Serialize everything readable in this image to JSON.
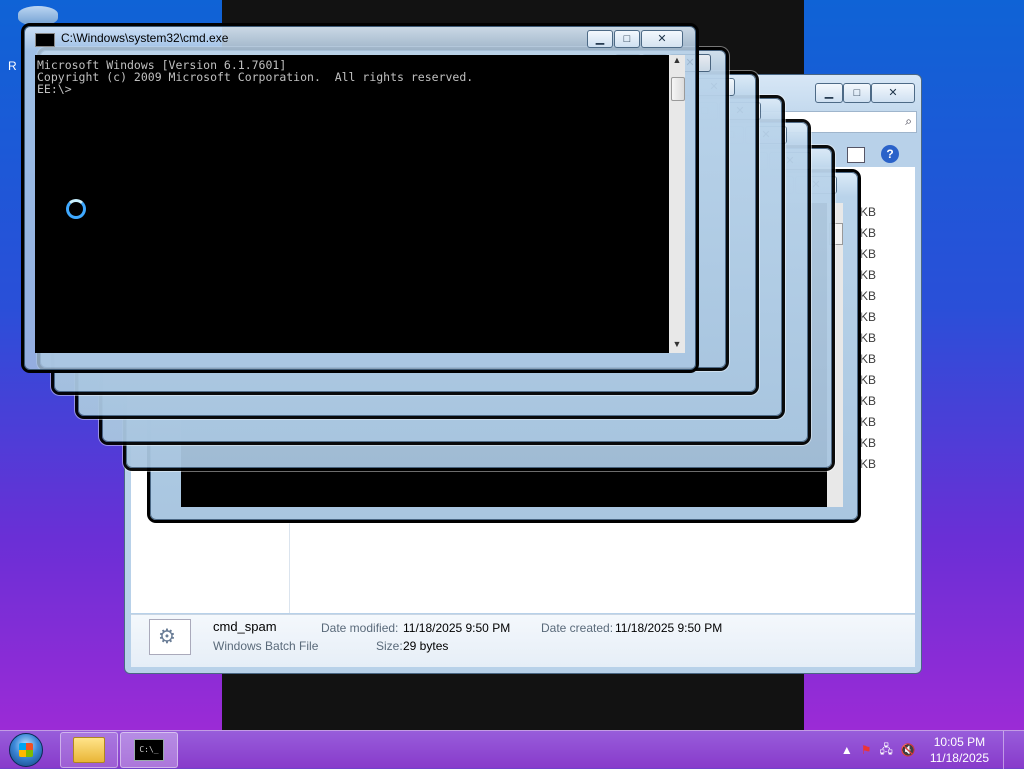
{
  "cmd": {
    "title": "C:\\Windows\\system32\\cmd.exe",
    "lines": [
      "Microsoft Windows [Version 6.1.7601]",
      "Copyright (c) 2009 Microsoft Corporation.  All rights reserved.",
      "",
      "EE:\\>"
    ]
  },
  "explorer": {
    "size_unit": "KB",
    "details": {
      "name": "cmd_spam",
      "type": "Windows Batch File",
      "modified_label": "Date modified:",
      "modified_value": "11/18/2025 9:50 PM",
      "created_label": "Date created:",
      "created_value": "11/18/2025 9:50 PM",
      "size_label": "Size:",
      "size_value": "29 bytes"
    }
  },
  "window_controls": {
    "minimize": "▁",
    "maximize": "□",
    "close": "✕"
  },
  "desktop": {
    "partial_label": "R"
  },
  "taskbar": {
    "time": "10:05 PM",
    "date": "11/18/2025",
    "cmd_icon_text": "C:\\_"
  }
}
